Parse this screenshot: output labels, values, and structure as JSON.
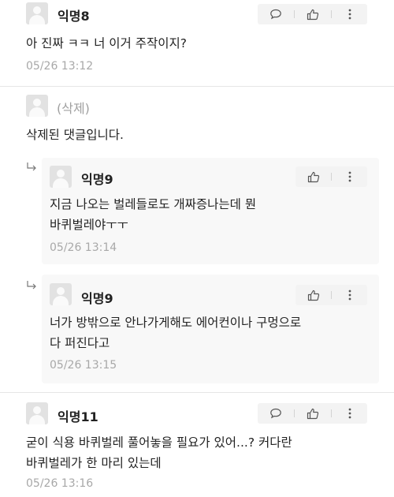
{
  "comments": [
    {
      "nickname": "익명8",
      "text": "아 진짜 ㅋㅋ 너 이거 주작이지?",
      "time": "05/26 13:12"
    },
    {
      "nickname": "(삭제)",
      "text": "삭제된 댓글입니다."
    },
    {
      "nickname": "익명9",
      "text": "지금 나오는 벌레들로도 개짜증나는데 뭔\n바퀴벌레야ㅜㅜ",
      "time": "05/26 13:14"
    },
    {
      "nickname": "익명9",
      "text": "너가 방밖으로 안나가게해도 에어컨이나 구멍으로\n다 퍼진다고",
      "time": "05/26 13:15"
    },
    {
      "nickname": "익명11",
      "text": "굳이 식용 바퀴벌레 풀어놓을 필요가 있어...? 커다란\n바퀴벌레가 한 마리 있는데",
      "time": "05/26 13:16"
    }
  ],
  "icons": {
    "reply": "speech-bubble-icon",
    "like": "thumbs-up-icon",
    "more": "more-vertical-icon",
    "reply_indicator": "reply-arrow-icon"
  },
  "colors": {
    "text": "#222222",
    "muted": "#a8a8a8",
    "action_bg": "#f3f3f3",
    "reply_bg": "#f8f8f8"
  }
}
